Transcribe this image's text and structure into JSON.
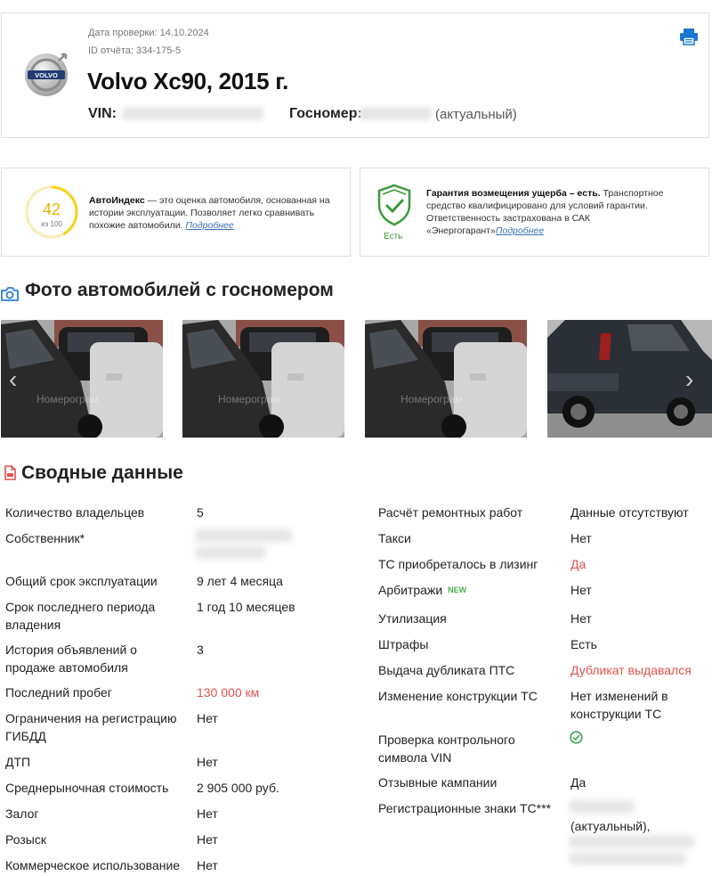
{
  "header": {
    "check_date": "Дата проверки: 14.10.2024",
    "report_id": "ID отчёта: 334-175-5",
    "car_title": "Volvo Xc90, 2015 г.",
    "vin_label": "VIN:",
    "plate_label": "Госномер:",
    "plate_status": "(актуальный)",
    "brand_logo": "volvo-logo",
    "print_icon": "printer-icon"
  },
  "autoindex": {
    "score": "42",
    "score_sub": "из 100",
    "title": "АвтоИндекс",
    "text": " — это оценка автомобиля, основанная на истории эксплуатации. Позволяет легко сравнивать похожие автомобили. ",
    "link": "Подробнее"
  },
  "guarantee": {
    "badge_label": "Есть",
    "title": "Гарантия возмещения ущерба – есть.",
    "text": " Транспортное средство квалифицировано для условий гарантии. Ответственность застрахована в САК «Энергогарант»",
    "link": "Подробнее"
  },
  "photos": {
    "title": "Фото автомобилей с госномером",
    "watermark": "Номерограм",
    "prev_arrow": "‹",
    "next_arrow": "›"
  },
  "summary": {
    "title": "Сводные данные",
    "left": [
      {
        "label": "Количество владельцев",
        "value": "5"
      },
      {
        "label": "Собственник*",
        "value": ""
      },
      {
        "label": "Общий срок эксплуатации",
        "value": "9 лет 4 месяца"
      },
      {
        "label": "Срок последнего периода владения",
        "value": "1 год 10 месяцев"
      },
      {
        "label": "История объявлений о продаже автомобиля",
        "value": "3"
      },
      {
        "label": "Последний пробег",
        "value": "130 000 км"
      },
      {
        "label": "Ограничения на регистрацию ГИБДД",
        "value": "Нет"
      },
      {
        "label": "ДТП",
        "value": "Нет"
      },
      {
        "label": "Среднерыночная стоимость",
        "value": "2 905 000 руб."
      },
      {
        "label": "Залог",
        "value": "Нет"
      },
      {
        "label": "Розыск",
        "value": "Нет"
      },
      {
        "label": "Коммерческое использование",
        "value": "Нет"
      }
    ],
    "right": [
      {
        "label": "Расчёт ремонтных работ",
        "value": "Данные отсутствуют"
      },
      {
        "label": "Такси",
        "value": "Нет"
      },
      {
        "label": "ТС приобреталось в лизинг",
        "value": "Да"
      },
      {
        "label": "Арбитражи",
        "badge": "NEW",
        "value": "Нет"
      },
      {
        "label": "Утилизация",
        "value": "Нет"
      },
      {
        "label": "Штрафы",
        "value": "Есть"
      },
      {
        "label": "Выдача дубликата ПТС",
        "value": "Дубликат выдавался"
      },
      {
        "label": "Изменение конструкции ТС",
        "value": "Нет изменений в конструкции ТС"
      },
      {
        "label": "Проверка контрольного символа VIN",
        "value": ""
      },
      {
        "label": "Отзывные кампании",
        "value": "Да"
      },
      {
        "label": "Регистрационные знаки ТС***",
        "value": "(актуальный),"
      }
    ]
  },
  "colors": {
    "accent_blue": "#1976d2",
    "warning_red": "#e0534f",
    "score_yellow": "#f5d21a",
    "ok_green": "#3a9a3a"
  }
}
